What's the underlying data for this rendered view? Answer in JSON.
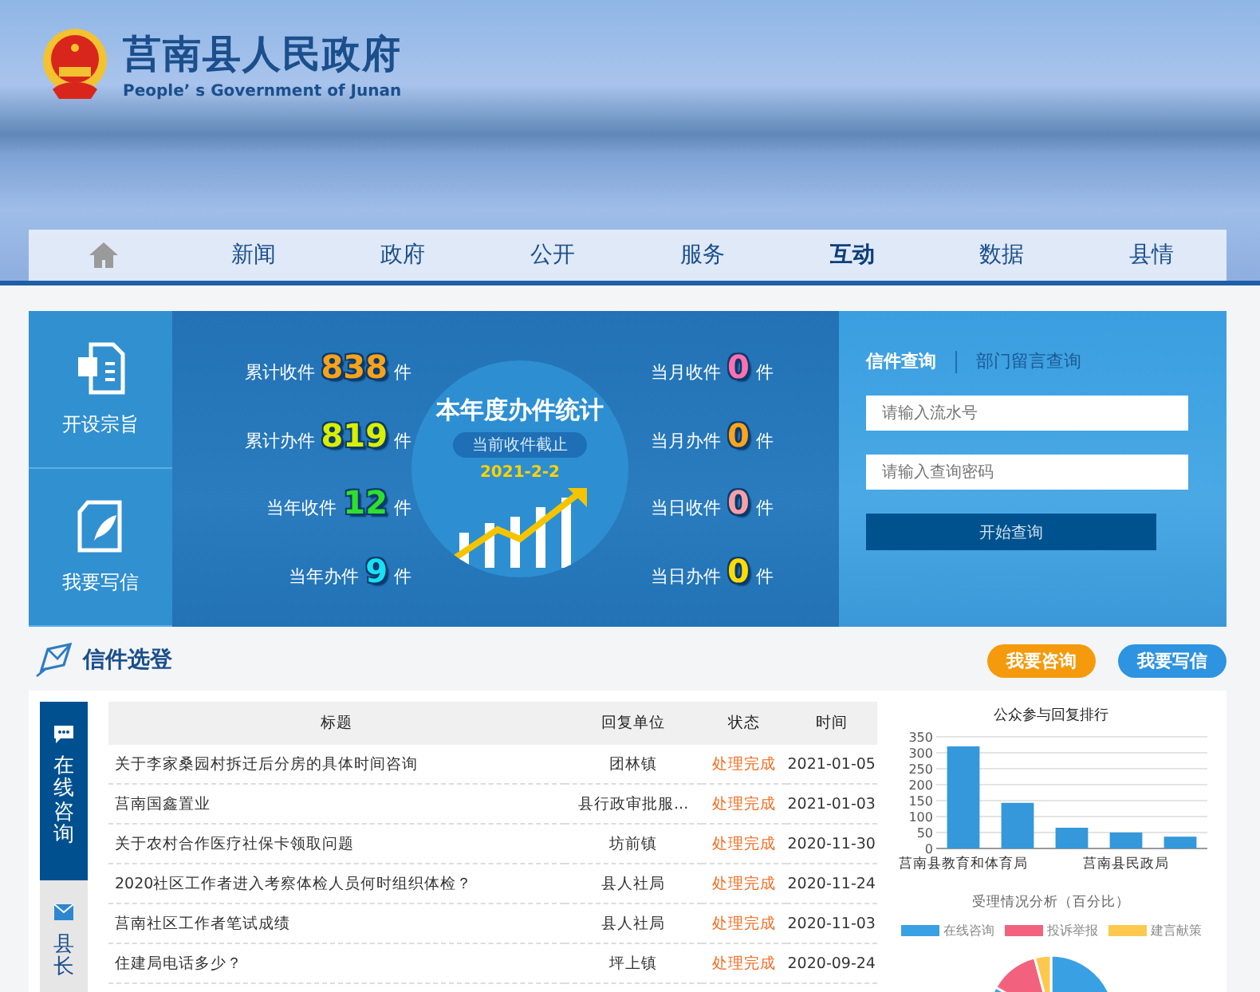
{
  "header": {
    "title": "莒南县人民政府",
    "subtitle": "People’ s Government of Junan"
  },
  "nav": [
    {
      "label": "新闻",
      "selected": false
    },
    {
      "label": "政府",
      "selected": false
    },
    {
      "label": "公开",
      "selected": false
    },
    {
      "label": "服务",
      "selected": false
    },
    {
      "label": "互动",
      "selected": true
    },
    {
      "label": "数据",
      "selected": false
    },
    {
      "label": "县情",
      "selected": false
    }
  ],
  "side_tiles": [
    {
      "label": "开设宗旨",
      "kind": "document"
    },
    {
      "label": "我要写信",
      "kind": "write"
    }
  ],
  "stats_left": [
    {
      "label": "累计收件",
      "value": "838",
      "unit": "件",
      "color": "#f7a21b"
    },
    {
      "label": "累计办件",
      "value": "819",
      "unit": "件",
      "color": "#d8f000"
    },
    {
      "label": "当年收件",
      "value": "12",
      "unit": "件",
      "color": "#2ee02e"
    },
    {
      "label": "当年办件",
      "value": "9",
      "unit": "件",
      "color": "#19e0f5"
    }
  ],
  "summary": {
    "title": "本年度办件统计",
    "subtitle": "当前收件截止",
    "date": "2021-2-2"
  },
  "stats_right": [
    {
      "label": "当月收件",
      "value": "0",
      "unit": "件",
      "color": "#ff70b0"
    },
    {
      "label": "当月办件",
      "value": "0",
      "unit": "件",
      "color": "#ffa41a"
    },
    {
      "label": "当日收件",
      "value": "0",
      "unit": "件",
      "color": "#f7a0a8"
    },
    {
      "label": "当日办件",
      "value": "0",
      "unit": "件",
      "color": "#ffdc00"
    }
  ],
  "query": {
    "tabs": [
      {
        "label": "信件查询",
        "selected": true
      },
      {
        "label": "部门留言查询",
        "selected": false
      }
    ],
    "fields": [
      {
        "placeholder": "请输入流水号"
      },
      {
        "placeholder": "请输入查询密码"
      }
    ],
    "button": "开始查询"
  },
  "section": {
    "title": "信件选登",
    "buttons": [
      {
        "label": "我要咨询",
        "kind": "consult"
      },
      {
        "label": "我要写信",
        "kind": "write"
      }
    ]
  },
  "letter_tabs": [
    {
      "label": "在线咨询",
      "kind": "chat",
      "selected": true
    },
    {
      "label": "县长",
      "kind": "mail",
      "selected": false
    }
  ],
  "table": {
    "columns": [
      "标题",
      "回复单位",
      "状态",
      "时间"
    ],
    "rows": [
      [
        "关于李家桑园村拆迁后分房的具体时间咨询",
        "团林镇",
        "处理完成",
        "2021-01-05"
      ],
      [
        "莒南国鑫置业",
        "县行政审批服...",
        "处理完成",
        "2021-01-03"
      ],
      [
        "关于农村合作医疗社保卡领取问题",
        "坊前镇",
        "处理完成",
        "2020-11-30"
      ],
      [
        "2020社区工作者进入考察体检人员何时组织体检？",
        "县人社局",
        "处理完成",
        "2020-11-24"
      ],
      [
        "莒南社区工作者笔试成绩",
        "县人社局",
        "处理完成",
        "2020-11-03"
      ],
      [
        "住建局电话多少？",
        "坪上镇",
        "处理完成",
        "2020-09-24"
      ]
    ]
  },
  "ranking": {
    "chart_data": {
      "type": "bar",
      "title": "公众参与回复排行",
      "values": [
        320,
        143,
        65,
        50,
        37
      ],
      "categories": [
        "莒南县教育和体育局",
        null,
        null,
        "莒南县民政局",
        null
      ],
      "grid": true,
      "ylim": [
        0,
        350
      ],
      "yticks": [
        0,
        50,
        100,
        150,
        200,
        250,
        300,
        350
      ],
      "color": "#3498db"
    }
  },
  "analysis": {
    "title": "受理情况分析（百分比）",
    "legend": [
      {
        "label": "在线咨询",
        "color": "#3aa0e4"
      },
      {
        "label": "投诉举报",
        "color": "#f2627f"
      },
      {
        "label": "建言献策",
        "color": "#fcc94e"
      }
    ]
  }
}
